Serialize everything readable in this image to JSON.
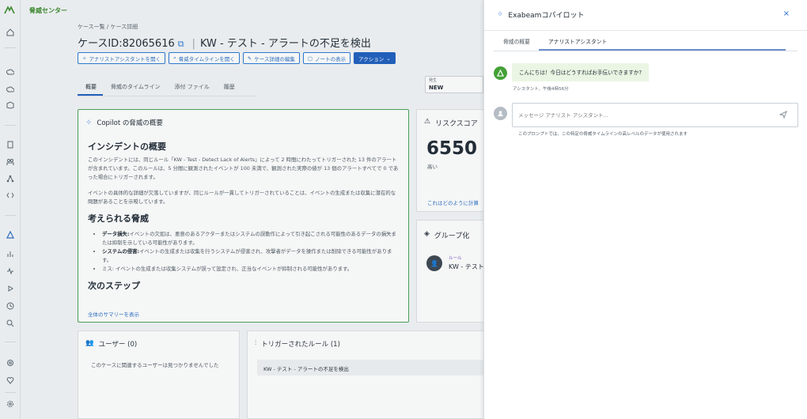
{
  "app": {
    "title": "脅威センター"
  },
  "breadcrumb": "ケース一覧 / ケース詳細",
  "case": {
    "id_label": "ケースID:82065616",
    "name": "KW - テスト - アラートの不足を検出"
  },
  "toolbar": {
    "analyst_assistant": "アナリストアシスタントを開く",
    "threat_timeline": "脅威タイムラインを開く",
    "edit_case": "ケース詳細の編集",
    "show_notes": "ノートの表示",
    "actions": "アクション"
  },
  "tabs": [
    "概要",
    "脅威のタイムライン",
    "添付 ファイル",
    "履歴"
  ],
  "status": {
    "label": "発生",
    "value": "NEW"
  },
  "summary": {
    "header": "Copilot の脅威の概要",
    "h_incident": "インシデントの概要",
    "p1": "このインシデントには、同じルール「KW - Test - Detect Lack of Alerts」によって 2 時間にわたってトリガーされた 13 件のアラートが含まれています。このルールは、5 分間に観測されたイベントが 100 未満で、観測された実際の値が 13 個のアラートすべてで 0 であった場合にトリガーされます。",
    "p2": "イベントの具体的な詳細が欠落していますが、同じルールが一貫してトリガーされていることは、イベントの生成または収集に潜在的な問題があることを示唆しています。",
    "h_threats": "考えられる脅威",
    "threats": [
      {
        "title": "データ損失:",
        "text": "イベントの欠如は、悪意のあるアクターまたはシステムの誤動作によって引き起こされる可能性のあるデータの損失または抑制を示している可能性があります。"
      },
      {
        "title": "システムの侵害:",
        "text": "イベントの生成または収集を行うシステムが侵害され、攻撃者がデータを操作または削除できる可能性があります。"
      },
      {
        "title": "",
        "text": "ミス: イベントの生成または収集システムが誤って設定され、正当なイベントが抑制される可能性があります。"
      }
    ],
    "h_next": "次のステップ",
    "more_link": "全体のサマリーを表示"
  },
  "risk": {
    "header": "リスクスコア",
    "score": "6550",
    "level": "高い",
    "link": "これはどのように計算"
  },
  "grouping": {
    "header": "グループ化",
    "avatar": "👤",
    "type": "ルール",
    "name": "KW - テスト"
  },
  "users": {
    "header": "ユーザー (0)",
    "empty": "このケースに関連するユーザーは見つかりませんでした"
  },
  "rules": {
    "header": "トリガーされたルール (1)",
    "row": "KW - テスト - アラートの不足を検出"
  },
  "copilot": {
    "title": "Exabeamコパイロット",
    "close": "×",
    "tabs": [
      "脅威の概要",
      "アナリストアシスタント"
    ],
    "greeting": "こんにちは！今日はどうすればお手伝いできますか?",
    "greeting_meta": "アシスタント、午後4時56分",
    "input_placeholder": "メッセージ アナリスト アシスタント...",
    "hint": "このプロンプトでは、この特定の脅威タイムラインの高レベルのデータが使用されます"
  },
  "colors": {
    "brand_green": "#3a8a2c",
    "accent_blue": "#1f5fbf",
    "bubble_green": "#eaf6e3"
  }
}
